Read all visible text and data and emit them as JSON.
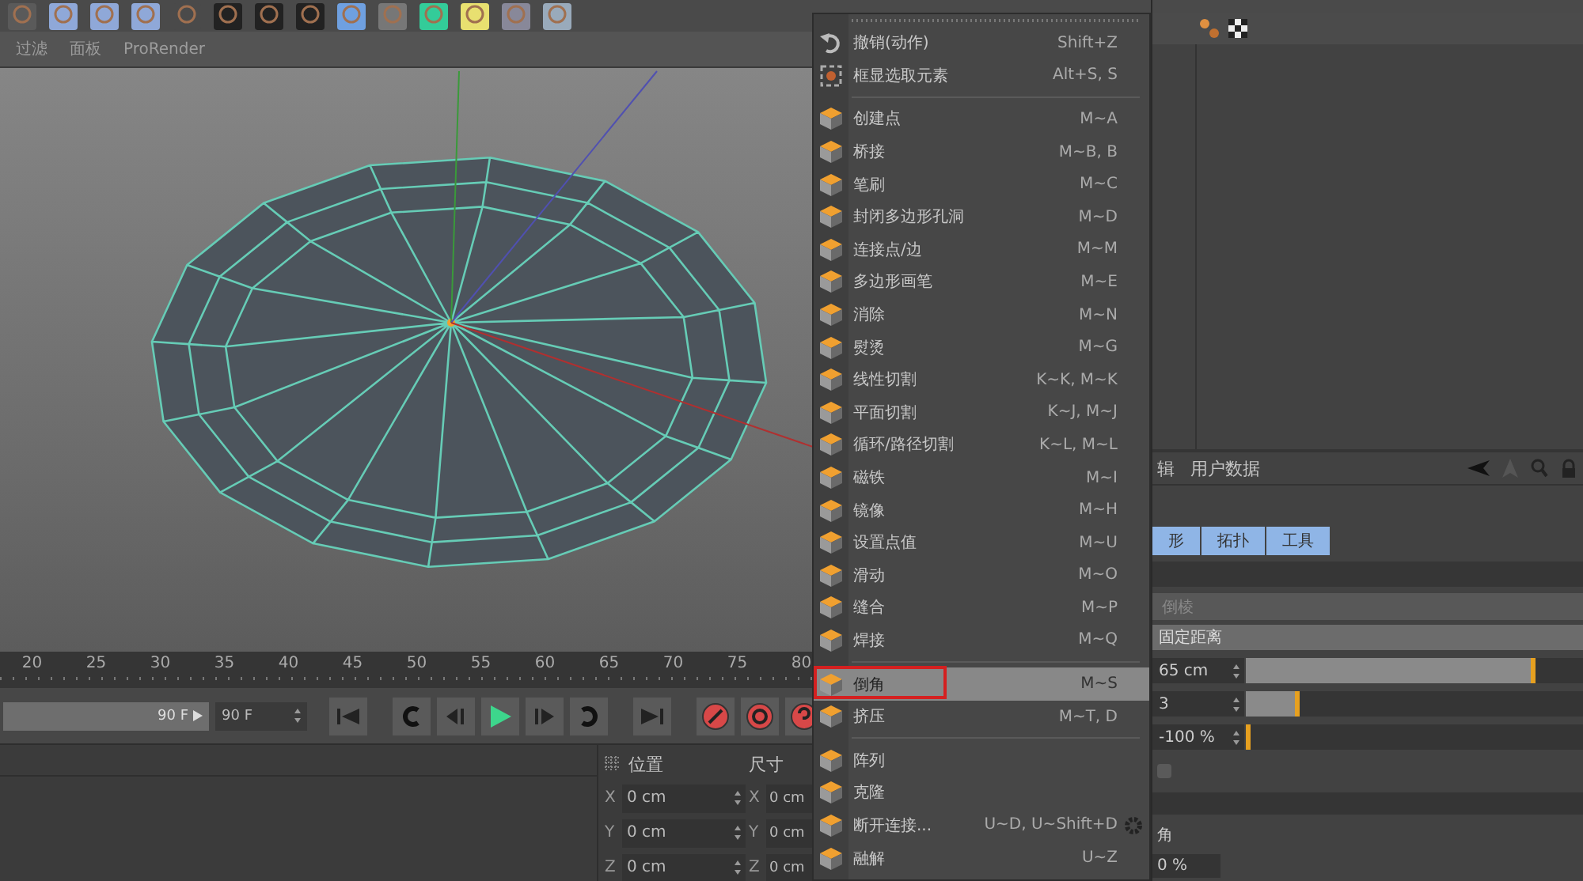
{
  "viewport": {
    "menu": [
      "过滤",
      "面板",
      "ProRender"
    ]
  },
  "timeline": {
    "ticks": [
      "20",
      "25",
      "30",
      "35",
      "40",
      "45",
      "50",
      "55",
      "60",
      "65",
      "70",
      "75",
      "80"
    ]
  },
  "playback": {
    "range_end": "90 F",
    "end_field": "90 F"
  },
  "coordinates": {
    "position_header": "位置",
    "size_header": "尺寸",
    "rows": [
      {
        "axis": "X",
        "position": "0 cm",
        "size_axis": "X",
        "size": "0 cm"
      },
      {
        "axis": "Y",
        "position": "0 cm",
        "size_axis": "Y",
        "size": "0 cm"
      },
      {
        "axis": "Z",
        "position": "0 cm",
        "size_axis": "Z",
        "size": "0 cm"
      }
    ]
  },
  "attributes": {
    "menu": [
      "辑",
      "用户数据"
    ],
    "tabs": [
      {
        "label": "形",
        "selected": true
      },
      {
        "label": "拓扑",
        "selected": true
      },
      {
        "label": "工具",
        "selected": true
      }
    ],
    "group_title": "倒棱",
    "mode": "固定距离",
    "sliders": [
      {
        "value": "65 cm",
        "level": 0.86
      },
      {
        "value": "3",
        "level": 0.16
      },
      {
        "value": "-100 %",
        "level": 0
      }
    ],
    "checkbox": {
      "checked": false
    },
    "corner_label": "角",
    "corner_value": "0 %"
  },
  "menu": {
    "groups": [
      {
        "items": [
          {
            "label": "撤销(动作)",
            "shortcut": "Shift+Z",
            "selected": false,
            "has_options": false
          },
          {
            "label": "框显选取元素",
            "shortcut": "Alt+S, S",
            "selected": false,
            "has_options": false
          }
        ]
      },
      {
        "items": [
          {
            "label": "创建点",
            "shortcut": "M~A",
            "selected": false,
            "has_options": false
          },
          {
            "label": "桥接",
            "shortcut": "M~B, B",
            "selected": false,
            "has_options": false
          },
          {
            "label": "笔刷",
            "shortcut": "M~C",
            "selected": false,
            "has_options": false
          },
          {
            "label": "封闭多边形孔洞",
            "shortcut": "M~D",
            "selected": false,
            "has_options": false
          },
          {
            "label": "连接点/边",
            "shortcut": "M~M",
            "selected": false,
            "has_options": false
          },
          {
            "label": "多边形画笔",
            "shortcut": "M~E",
            "selected": false,
            "has_options": false
          },
          {
            "label": "消除",
            "shortcut": "M~N",
            "selected": false,
            "has_options": false
          },
          {
            "label": "熨烫",
            "shortcut": "M~G",
            "selected": false,
            "has_options": false
          },
          {
            "label": "线性切割",
            "shortcut": "K~K, M~K",
            "selected": false,
            "has_options": false
          },
          {
            "label": "平面切割",
            "shortcut": "K~J, M~J",
            "selected": false,
            "has_options": false
          },
          {
            "label": "循环/路径切割",
            "shortcut": "K~L, M~L",
            "selected": false,
            "has_options": false
          },
          {
            "label": "磁铁",
            "shortcut": "M~I",
            "selected": false,
            "has_options": false
          },
          {
            "label": "镜像",
            "shortcut": "M~H",
            "selected": false,
            "has_options": false
          },
          {
            "label": "设置点值",
            "shortcut": "M~U",
            "selected": false,
            "has_options": false
          },
          {
            "label": "滑动",
            "shortcut": "M~O",
            "selected": false,
            "has_options": false
          },
          {
            "label": "缝合",
            "shortcut": "M~P",
            "selected": false,
            "has_options": false
          },
          {
            "label": "焊接",
            "shortcut": "M~Q",
            "selected": false,
            "has_options": false
          }
        ]
      },
      {
        "items": [
          {
            "label": "倒角",
            "shortcut": "M~S",
            "selected": true,
            "has_options": false
          },
          {
            "label": "挤压",
            "shortcut": "M~T, D",
            "selected": false,
            "has_options": false
          }
        ]
      },
      {
        "items": [
          {
            "label": "阵列",
            "selected": false,
            "has_options": false
          },
          {
            "label": "克隆",
            "selected": false,
            "has_options": false
          },
          {
            "label": "断开连接...",
            "shortcut": "U~D, U~Shift+D",
            "selected": false,
            "has_options": true
          },
          {
            "label": "融解",
            "shortcut": "U~Z",
            "selected": false,
            "has_options": false
          }
        ]
      }
    ]
  }
}
